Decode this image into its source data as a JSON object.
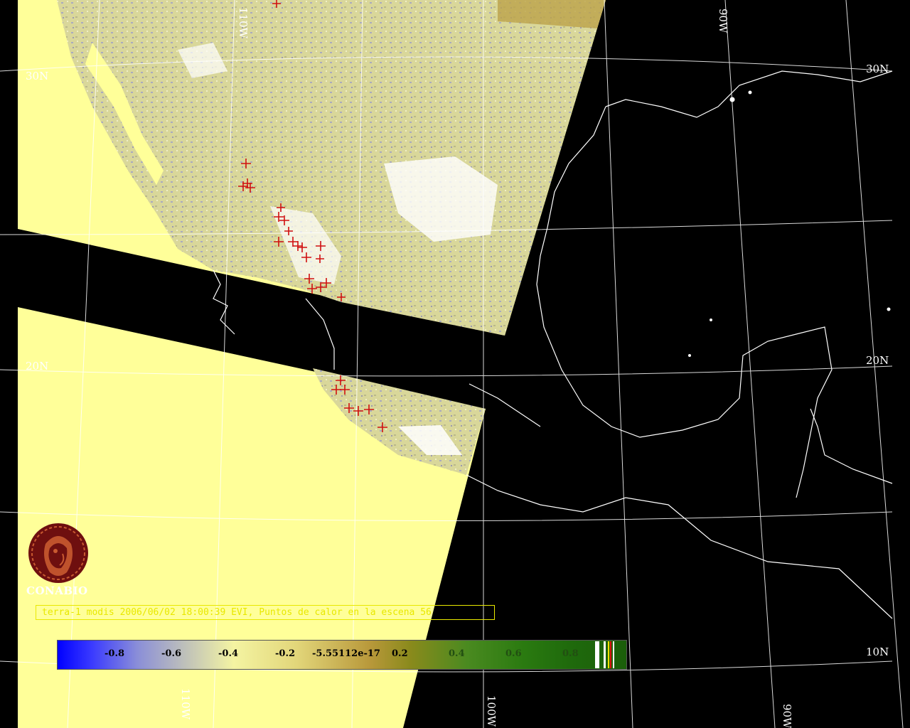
{
  "map": {
    "lat_labels": [
      "30N",
      "20N",
      "30N",
      "20N",
      "10N"
    ],
    "lon_labels": [
      "110W",
      "90W",
      "100W",
      "90W",
      "110W"
    ]
  },
  "caption": "terra-1 modis 2006/06/02 18:00:39 EVI, Puntos de calor en la escena 56",
  "logo": {
    "text": "CONABIO"
  },
  "colorbar": {
    "ticks": [
      "-0.8",
      "-0.6",
      "-0.4",
      "-0.2",
      "-5.55112e-17",
      "0.2",
      "0.4",
      "0.6",
      "0.8"
    ],
    "colors": {
      "low": "#0000ff",
      "mid": "#f4f4a2",
      "high": "#1b5e0a"
    }
  },
  "colors": {
    "background": "#000000",
    "nodata": "#ffff99",
    "coast": "#ffffff",
    "fire": "#d01010",
    "caption": "#e8e800"
  }
}
